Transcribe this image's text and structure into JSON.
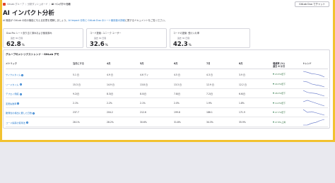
{
  "breadcrumb": {
    "items": [
      "GitLab グループ",
      "分析ダッシュボード"
    ],
    "current": "AI インパクト分析"
  },
  "header": {
    "title": "AI インパクト分析",
    "button_label": "GitLab Duo でチャット",
    "description_pre": "AI 機能が GitLab の他の機能に与える影響を理解しましょう。",
    "description_link": "AI Impact 分析と GitLab Duo のシート使用量の詳細",
    "description_post": "に関するドキュメントをご覧ください。"
  },
  "cards": [
    {
      "title": "Duo Pro シート割り当て済みおよび使用済み",
      "period": "過去 30 日間",
      "value": "62.8",
      "unit": "%"
    },
    {
      "title": "コード提案: ユニーク ユーザー",
      "period": "過去 30 日間",
      "value": "32.6",
      "unit": "%"
    },
    {
      "title": "コードの提案: 受け入れ率",
      "period": "過去 30 日間",
      "value": "42.3",
      "unit": "%"
    }
  ],
  "table": {
    "title": "グループのメトリクストレンド - GitLab デモ",
    "headers": [
      "メトリック",
      "当月にする",
      "4月",
      "5月",
      "6月",
      "7月",
      "8月",
      "増減率 (%)\n過去 6 か月",
      "トレンド"
    ],
    "rows": [
      {
        "metric": "サイクルタイム",
        "values": [
          "5.1 日",
          "4.9 日",
          "4.6 デイ",
          "4.5 日",
          "4.3 日",
          "3.9 日"
        ],
        "change": "23.5%低下",
        "trend": [
          5.1,
          4.9,
          4.6,
          4.5,
          4.3,
          3.9
        ]
      },
      {
        "metric": "リードタイム",
        "values": [
          "15.3 日",
          "14.9 日",
          "13.8 日",
          "13.3 日",
          "12.9 日",
          "12.2 日"
        ],
        "change": "20.3%低下",
        "trend": [
          15.3,
          14.9,
          13.8,
          13.3,
          12.9,
          12.2
        ]
      },
      {
        "metric": "デプロイ頻度",
        "values": [
          "9.2/日",
          "8.3/日",
          "8.0/日",
          "7.8/日",
          "7.2/日",
          "6.6/日"
        ],
        "change": "28.3%低下",
        "trend": [
          9.2,
          8.3,
          8.0,
          7.8,
          7.2,
          6.6
        ]
      },
      {
        "metric": "変更失敗率",
        "values": [
          "2.1%",
          "2.2%",
          "2.1%",
          "2.0%",
          "1.9%",
          "1.8%"
        ],
        "change": "14.3%低下",
        "trend": [
          2.1,
          2.2,
          2.1,
          2.0,
          1.9,
          1.8
        ]
      },
      {
        "metric": "脆弱性の検出に要した日数",
        "values": [
          "237.7",
          "204.2",
          "212.6",
          "199.8",
          "186.1",
          "171.9"
        ],
        "change": "27.7%低下",
        "trend": [
          237.7,
          204.2,
          212.6,
          199.8,
          186.1,
          171.9
        ]
      },
      {
        "metric": "コード提案の使用法",
        "values": [
          "28.1%",
          "28.2%",
          "30.6%",
          "31.8%",
          "34.3%",
          "35.9%"
        ],
        "change": "27.8%上昇",
        "trend": [
          28.1,
          28.2,
          30.6,
          31.8,
          34.3,
          35.9
        ]
      }
    ]
  },
  "colors": {
    "link": "#1f75cb",
    "accent_border": "#f2c230",
    "down": "#217645"
  }
}
